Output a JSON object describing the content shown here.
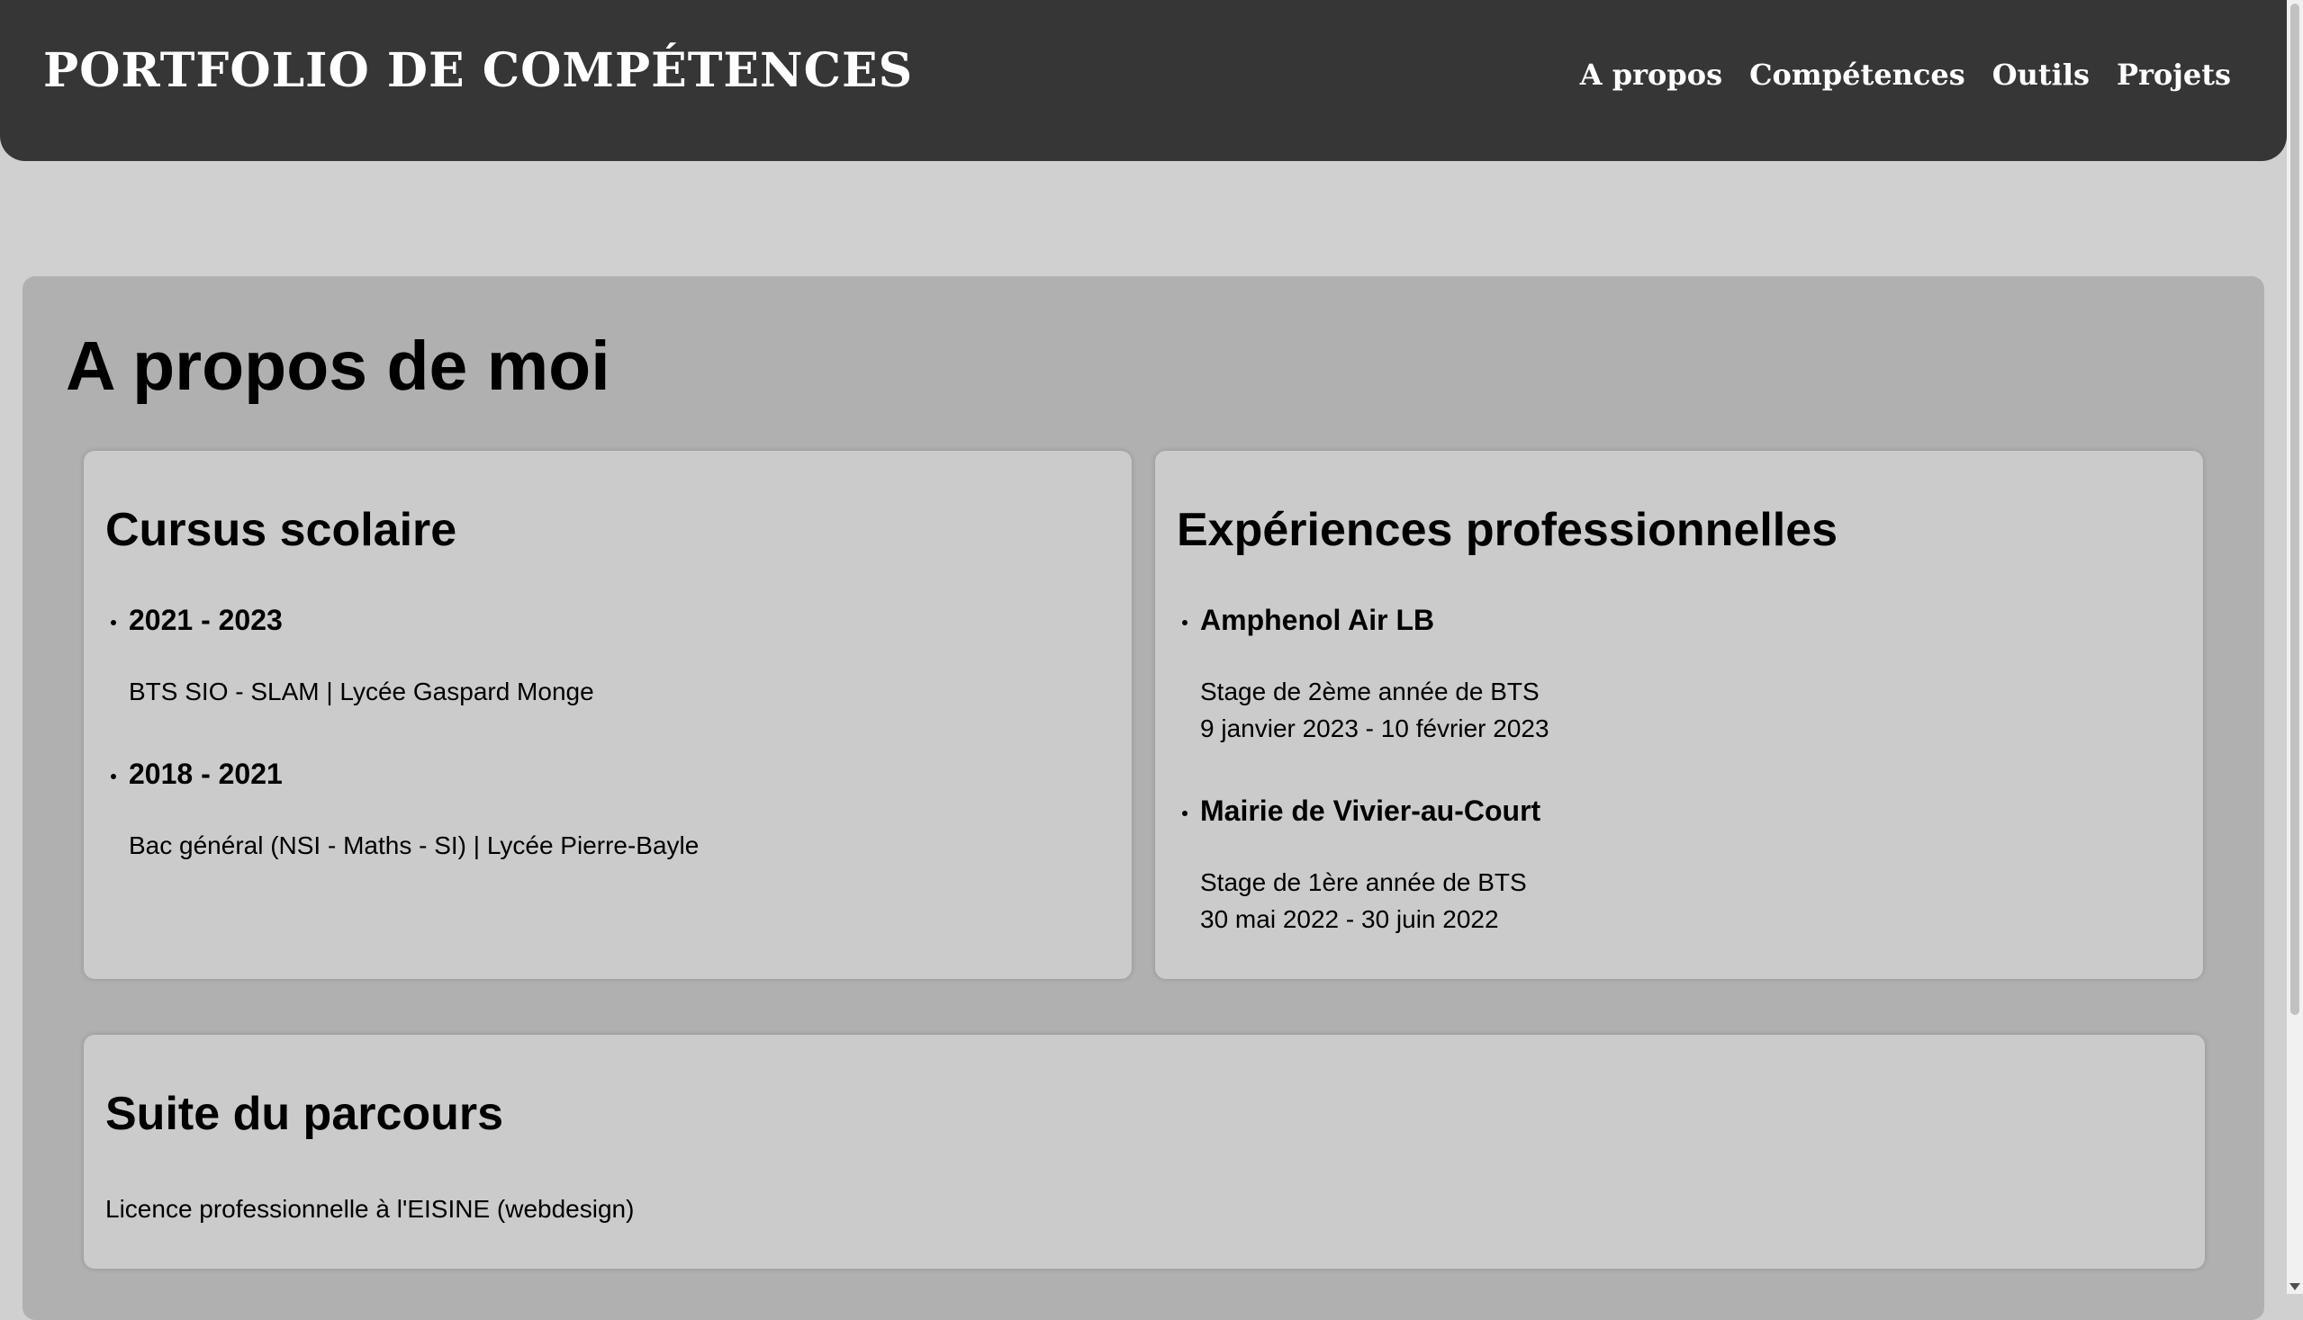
{
  "header": {
    "site_title": "PORTFOLIO DE COMPÉTENCES",
    "nav": [
      "A propos",
      "Compétences",
      "Outils",
      "Projets"
    ]
  },
  "about": {
    "title": "A propos de moi",
    "education": {
      "title": "Cursus scolaire",
      "entries": [
        {
          "years": "2021 - 2023",
          "detail": "BTS SIO - SLAM | Lycée Gaspard Monge"
        },
        {
          "years": "2018 - 2021",
          "detail": "Bac général (NSI - Maths - SI) | Lycée Pierre-Bayle"
        }
      ]
    },
    "experience": {
      "title": "Expériences professionnelles",
      "entries": [
        {
          "company": "Amphenol Air LB",
          "role": "Stage de 2ème année de BTS",
          "dates": "9 janvier 2023 - 10 février 2023"
        },
        {
          "company": "Mairie de Vivier-au-Court",
          "role": "Stage de 1ère année de BTS",
          "dates": "30 mai 2022 - 30 juin 2022"
        }
      ]
    },
    "next_steps": {
      "title": "Suite du parcours",
      "text": "Licence professionnelle à l'EISINE (webdesign)"
    }
  },
  "colors": {
    "header_bg": "#363636",
    "page_bg": "#d0d0d0",
    "section_bg": "#b0b0b0",
    "card_bg": "#cbcbcb"
  }
}
